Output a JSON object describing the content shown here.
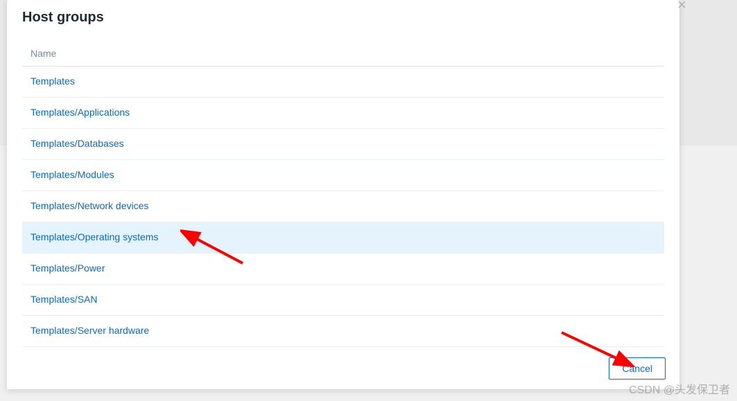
{
  "modal": {
    "title": "Host groups",
    "column_header": "Name",
    "items": [
      {
        "label": "Templates",
        "highlighted": false
      },
      {
        "label": "Templates/Applications",
        "highlighted": false
      },
      {
        "label": "Templates/Databases",
        "highlighted": false
      },
      {
        "label": "Templates/Modules",
        "highlighted": false
      },
      {
        "label": "Templates/Network devices",
        "highlighted": false
      },
      {
        "label": "Templates/Operating systems",
        "highlighted": true
      },
      {
        "label": "Templates/Power",
        "highlighted": false
      },
      {
        "label": "Templates/SAN",
        "highlighted": false
      },
      {
        "label": "Templates/Server hardware",
        "highlighted": false
      }
    ],
    "cancel_label": "Cancel",
    "close_glyph": "×"
  },
  "watermark": "CSDN @头发保卫者",
  "annotations": {
    "arrow_color": "#ff0000"
  }
}
